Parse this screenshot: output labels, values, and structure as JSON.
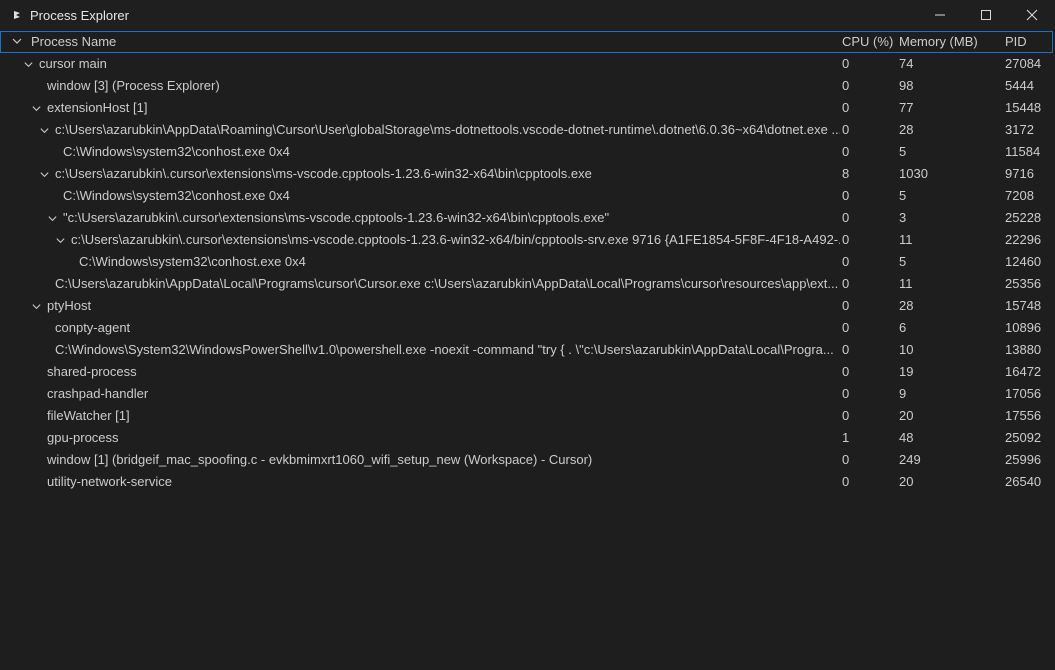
{
  "window": {
    "title": "Process Explorer"
  },
  "columns": {
    "name": "Process Name",
    "cpu": "CPU (%)",
    "memory": "Memory (MB)",
    "pid": "PID"
  },
  "rows": [
    {
      "depth": 0,
      "expandable": true,
      "name": "cursor main",
      "cpu": "0",
      "memory": "74",
      "pid": "27084"
    },
    {
      "depth": 1,
      "expandable": false,
      "name": "window [3] (Process Explorer)",
      "cpu": "0",
      "memory": "98",
      "pid": "5444"
    },
    {
      "depth": 1,
      "expandable": true,
      "name": "extensionHost [1]",
      "cpu": "0",
      "memory": "77",
      "pid": "15448"
    },
    {
      "depth": 2,
      "expandable": true,
      "name": "c:\\Users\\azarubkin\\AppData\\Roaming\\Cursor\\User\\globalStorage\\ms-dotnettools.vscode-dotnet-runtime\\.dotnet\\6.0.36~x64\\dotnet.exe ...",
      "cpu": "0",
      "memory": "28",
      "pid": "3172"
    },
    {
      "depth": 3,
      "expandable": false,
      "name": "C:\\Windows\\system32\\conhost.exe 0x4",
      "cpu": "0",
      "memory": "5",
      "pid": "11584"
    },
    {
      "depth": 2,
      "expandable": true,
      "name": "c:\\Users\\azarubkin\\.cursor\\extensions\\ms-vscode.cpptools-1.23.6-win32-x64\\bin\\cpptools.exe",
      "cpu": "8",
      "memory": "1030",
      "pid": "9716"
    },
    {
      "depth": 3,
      "expandable": false,
      "name": "C:\\Windows\\system32\\conhost.exe 0x4",
      "cpu": "0",
      "memory": "5",
      "pid": "7208"
    },
    {
      "depth": 3,
      "expandable": true,
      "name": "\"c:\\Users\\azarubkin\\.cursor\\extensions\\ms-vscode.cpptools-1.23.6-win32-x64\\bin\\cpptools.exe\"",
      "cpu": "0",
      "memory": "3",
      "pid": "25228"
    },
    {
      "depth": 4,
      "expandable": true,
      "name": "c:\\Users\\azarubkin\\.cursor\\extensions\\ms-vscode.cpptools-1.23.6-win32-x64/bin/cpptools-srv.exe 9716 {A1FE1854-5F8F-4F18-A492-...",
      "cpu": "0",
      "memory": "11",
      "pid": "22296"
    },
    {
      "depth": 5,
      "expandable": false,
      "name": "C:\\Windows\\system32\\conhost.exe 0x4",
      "cpu": "0",
      "memory": "5",
      "pid": "12460"
    },
    {
      "depth": 2,
      "expandable": false,
      "name": "C:\\Users\\azarubkin\\AppData\\Local\\Programs\\cursor\\Cursor.exe c:\\Users\\azarubkin\\AppData\\Local\\Programs\\cursor\\resources\\app\\ext...",
      "cpu": "0",
      "memory": "11",
      "pid": "25356"
    },
    {
      "depth": 1,
      "expandable": true,
      "name": "ptyHost",
      "cpu": "0",
      "memory": "28",
      "pid": "15748"
    },
    {
      "depth": 2,
      "expandable": false,
      "name": "conpty-agent",
      "cpu": "0",
      "memory": "6",
      "pid": "10896"
    },
    {
      "depth": 2,
      "expandable": false,
      "name": "C:\\Windows\\System32\\WindowsPowerShell\\v1.0\\powershell.exe -noexit -command \"try { . \\\"c:\\Users\\azarubkin\\AppData\\Local\\Progra...",
      "cpu": "0",
      "memory": "10",
      "pid": "13880"
    },
    {
      "depth": 1,
      "expandable": false,
      "name": "shared-process",
      "cpu": "0",
      "memory": "19",
      "pid": "16472"
    },
    {
      "depth": 1,
      "expandable": false,
      "name": "crashpad-handler",
      "cpu": "0",
      "memory": "9",
      "pid": "17056"
    },
    {
      "depth": 1,
      "expandable": false,
      "name": "fileWatcher [1]",
      "cpu": "0",
      "memory": "20",
      "pid": "17556"
    },
    {
      "depth": 1,
      "expandable": false,
      "name": "gpu-process",
      "cpu": "1",
      "memory": "48",
      "pid": "25092"
    },
    {
      "depth": 1,
      "expandable": false,
      "name": "window [1] (bridgeif_mac_spoofing.c - evkbmimxrt1060_wifi_setup_new (Workspace) - Cursor)",
      "cpu": "0",
      "memory": "249",
      "pid": "25996"
    },
    {
      "depth": 1,
      "expandable": false,
      "name": "utility-network-service",
      "cpu": "0",
      "memory": "20",
      "pid": "26540"
    }
  ]
}
